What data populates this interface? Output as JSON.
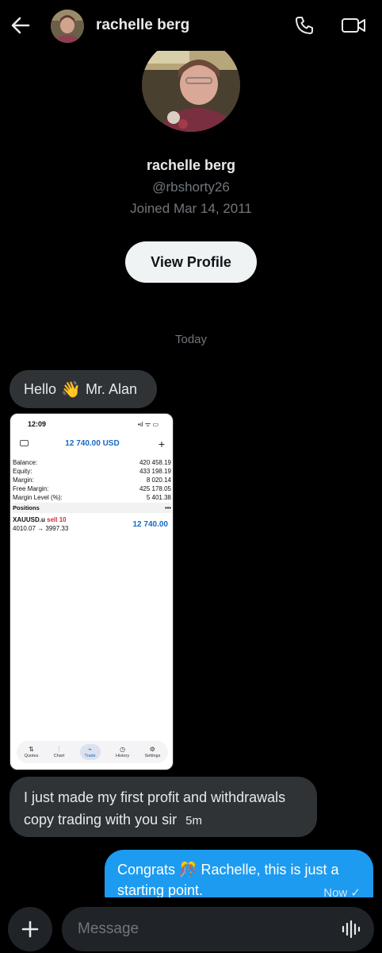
{
  "header": {
    "contact_name": "rachelle berg"
  },
  "profile": {
    "name": "rachelle berg",
    "handle": "@rbshorty26",
    "joined": "Joined Mar 14, 2011",
    "view_profile_label": "View Profile"
  },
  "date_divider": "Today",
  "messages": [
    {
      "text_before": "Hello",
      "emoji": "👋",
      "text_after": "Mr. Alan"
    },
    {
      "type": "image"
    },
    {
      "text": "I just made my first profit and withdrawals copy trading with you sir",
      "time": "5m"
    },
    {
      "text": "Congrats 🎊 Rachelle, this is just a starting point.",
      "time": "Now ✓"
    }
  ],
  "screenshot": {
    "time": "12:09",
    "status": "•ıl ᯤ ▭",
    "balance_header": "12 740.00 USD",
    "rows": [
      {
        "label": "Balance:",
        "value": "420 458.19"
      },
      {
        "label": "Equity:",
        "value": "433 198.19"
      },
      {
        "label": "Margin:",
        "value": "8 020.14"
      },
      {
        "label": "Free Margin:",
        "value": "425 178.05"
      },
      {
        "label": "Margin Level (%):",
        "value": "5 401.38"
      }
    ],
    "positions_label": "Positions",
    "positions_more": "•••",
    "trade": {
      "symbol": "XAUUSD.u",
      "side": "sell 10",
      "prices": "4010.07 → 3997.33",
      "profit": "12 740.00"
    },
    "nav": [
      {
        "icon": "⇅",
        "label": "Quotes"
      },
      {
        "icon": "⫶",
        "label": "Chart"
      },
      {
        "icon": "⌁",
        "label": "Trade"
      },
      {
        "icon": "◷",
        "label": "History"
      },
      {
        "icon": "⚙",
        "label": "Settings"
      }
    ]
  },
  "composer": {
    "placeholder": "Message"
  },
  "colors": {
    "background": "#000000",
    "incoming_bubble": "#2f3336",
    "outgoing_bubble": "#1d9bf0",
    "muted_text": "#71767b"
  }
}
